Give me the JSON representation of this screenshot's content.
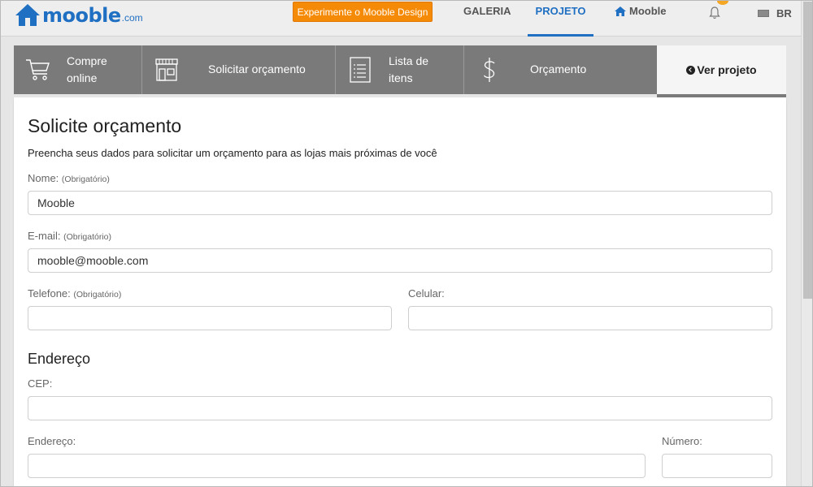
{
  "header": {
    "logo_text": "mooble",
    "logo_suffix": ".com",
    "promo_label": "Experimente o Mooble Design",
    "nav": {
      "galeria": "GALERIA",
      "projeto": "PROJETO",
      "mooble": "Mooble"
    },
    "language": "BR"
  },
  "steps": {
    "compre_line1": "Compre",
    "compre_line2": "online",
    "solicitar": "Solicitar orçamento",
    "lista_line1": "Lista de",
    "lista_line2": "itens",
    "orcamento": "Orçamento",
    "ver_projeto": "Ver projeto"
  },
  "form": {
    "title": "Solicite orçamento",
    "subtitle": "Preencha seus dados para solicitar um orçamento para as lojas mais próximas de você",
    "required_note": "(Obrigatório)",
    "nome_label": "Nome:",
    "nome_value": "Mooble",
    "email_label": "E-mail:",
    "email_value": "mooble@mooble.com",
    "telefone_label": "Telefone:",
    "telefone_value": "",
    "celular_label": "Celular:",
    "celular_value": "",
    "endereco_section": "Endereço",
    "cep_label": "CEP:",
    "cep_value": "",
    "endereco_label": "Endereço:",
    "endereco_value": "",
    "numero_label": "Número:",
    "numero_value": ""
  },
  "colors": {
    "brand_blue": "#1f6fc2",
    "promo_orange": "#f58a07",
    "step_gray": "#7a7a7a"
  },
  "icons": [
    "home-icon",
    "bell-icon",
    "flag-icon",
    "cart-icon",
    "store-icon",
    "list-icon",
    "dollar-icon",
    "chevron-left-circle-icon"
  ]
}
